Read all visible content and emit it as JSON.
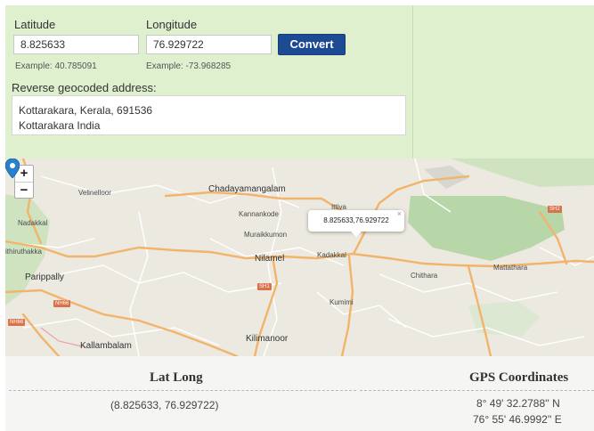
{
  "form": {
    "latitude_label": "Latitude",
    "latitude_value": "8.825633",
    "latitude_example": "Example: 40.785091",
    "longitude_label": "Longitude",
    "longitude_value": "76.929722",
    "longitude_example": "Example: -73.968285",
    "convert_label": "Convert",
    "reverse_label": "Reverse geocoded address:",
    "address_line1": "Kottarakara, Kerala, 691536",
    "address_line2": "Kottarakara India"
  },
  "map": {
    "zoom_in": "+",
    "zoom_out": "−",
    "popup_text": "8.825633,76.929722",
    "popup_close": "×",
    "places": {
      "velinelloor": "Velinelloor",
      "chadayamangalam": "Chadayamangalam",
      "ittiva": "Ittiva",
      "kannankode": "Kannankode",
      "nadakkal": "Nadakkal",
      "muraikkumon": "Muraikkumon",
      "ithikkara": "ithiruthakka",
      "nilamel": "Nilamel",
      "kadakkal": "Kadakkal",
      "chithara": "Chithara",
      "mattathara": "Mattathara",
      "parippally": "Parippally",
      "kumimi": "Kumimi",
      "kallambalam": "Kallambalam",
      "kilmanoor": "Kilimanoor"
    },
    "shields": {
      "sh2": "SH2",
      "sh1": "SH1",
      "nh66a": "NH66",
      "nh66b": "NH66"
    },
    "colors": {
      "land": "#ece9e1",
      "forest": "#b7d7a8",
      "major_road": "#f2b46a",
      "minor_road": "#ffffff",
      "marker": "#2a81cb"
    }
  },
  "table": {
    "col1_header": "Lat Long",
    "col2_header": "GPS Coordinates",
    "col1_value": "(8.825633, 76.929722)",
    "col2_value_line1": "8° 49' 32.2788'' N",
    "col2_value_line2": "76° 55' 46.9992'' E"
  }
}
